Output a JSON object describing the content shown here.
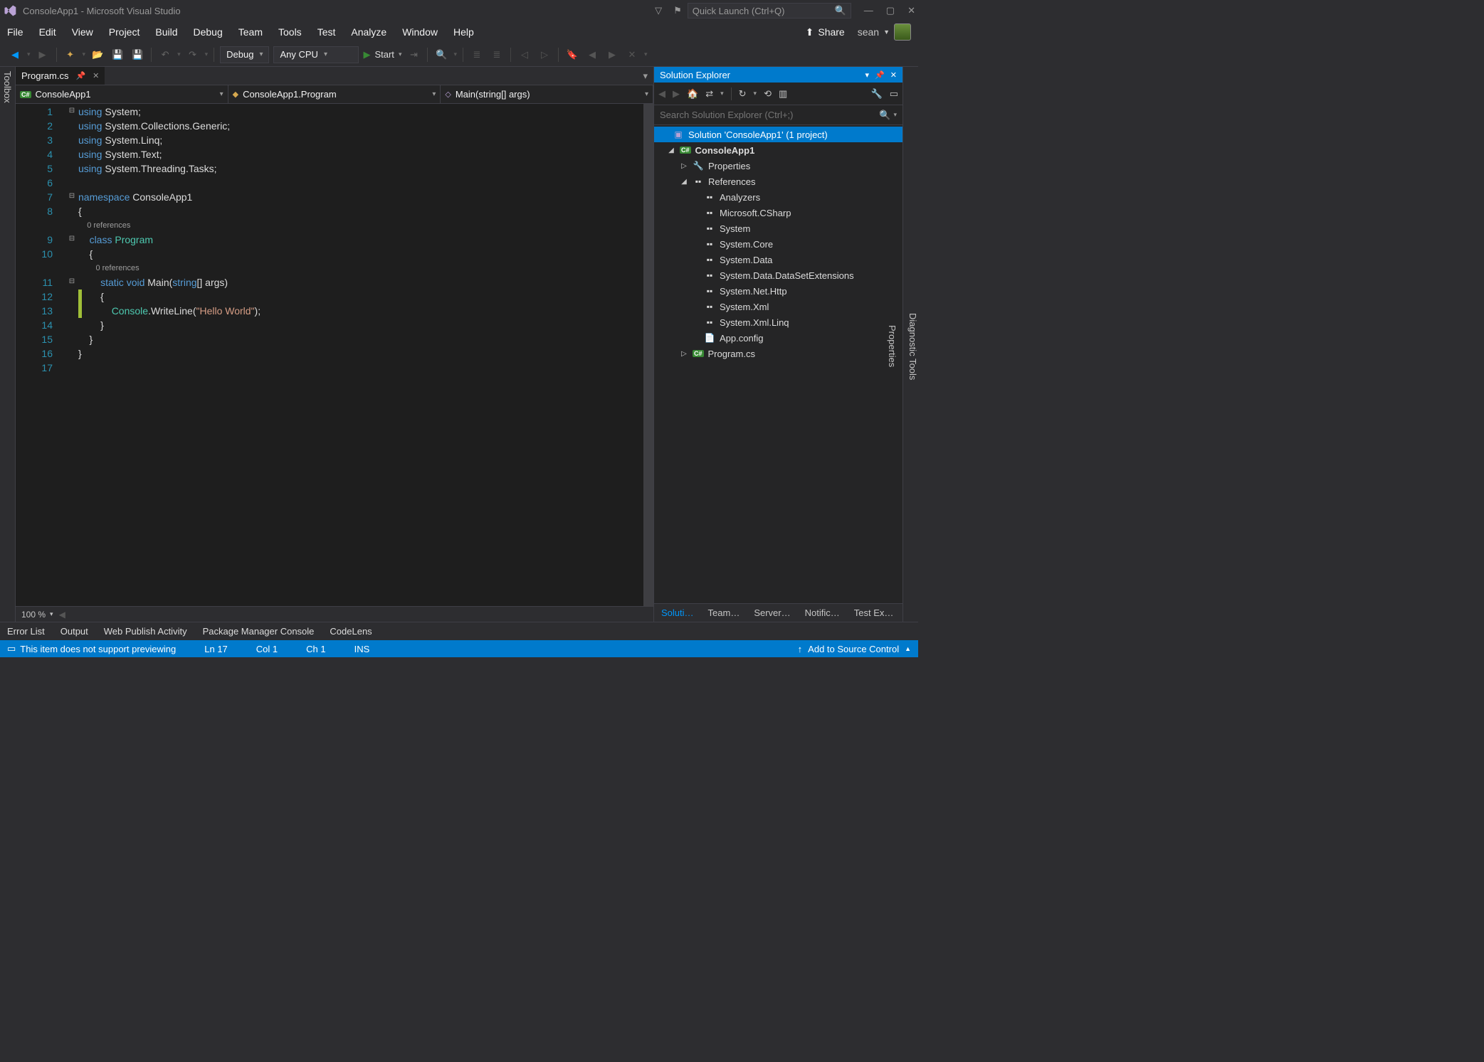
{
  "window": {
    "title": "ConsoleApp1 - Microsoft Visual Studio"
  },
  "quicklaunch": {
    "placeholder": "Quick Launch (Ctrl+Q)"
  },
  "menubar": {
    "items": [
      "File",
      "Edit",
      "View",
      "Project",
      "Build",
      "Debug",
      "Team",
      "Tools",
      "Test",
      "Analyze",
      "Window",
      "Help"
    ],
    "share": "Share",
    "user": "sean"
  },
  "toolbar": {
    "config": "Debug",
    "platform": "Any CPU",
    "start": "Start"
  },
  "left_tabs": [
    "Toolbox"
  ],
  "right_tabs": [
    "Diagnostic Tools",
    "Properties"
  ],
  "document": {
    "tab": "Program.cs",
    "nav1": "ConsoleApp1",
    "nav2": "ConsoleApp1.Program",
    "nav3": "Main(string[] args)",
    "refs": "0 references",
    "lines": [
      {
        "n": 1,
        "fold": "⊟",
        "tokens": [
          [
            "using ",
            "k-blue"
          ],
          [
            "System;",
            ""
          ]
        ]
      },
      {
        "n": 2,
        "fold": "",
        "tokens": [
          [
            "using ",
            "k-blue"
          ],
          [
            "System.Collections.Generic;",
            ""
          ]
        ]
      },
      {
        "n": 3,
        "fold": "",
        "tokens": [
          [
            "using ",
            "k-blue"
          ],
          [
            "System.Linq;",
            ""
          ]
        ]
      },
      {
        "n": 4,
        "fold": "",
        "tokens": [
          [
            "using ",
            "k-blue"
          ],
          [
            "System.Text;",
            ""
          ]
        ]
      },
      {
        "n": 5,
        "fold": "",
        "tokens": [
          [
            "using ",
            "k-blue"
          ],
          [
            "System.Threading.Tasks;",
            ""
          ]
        ]
      },
      {
        "n": 6,
        "fold": "",
        "tokens": [
          [
            "",
            ""
          ]
        ]
      },
      {
        "n": 7,
        "fold": "⊟",
        "tokens": [
          [
            "namespace ",
            "k-blue"
          ],
          [
            "ConsoleApp1",
            ""
          ]
        ]
      },
      {
        "n": 8,
        "fold": "",
        "tokens": [
          [
            "{",
            ""
          ]
        ]
      },
      {
        "ref": "    0 references"
      },
      {
        "n": 9,
        "fold": "⊟",
        "tokens": [
          [
            "    ",
            ""
          ],
          [
            "class ",
            "k-blue"
          ],
          [
            "Program",
            "k-teal"
          ]
        ]
      },
      {
        "n": 10,
        "fold": "",
        "tokens": [
          [
            "    {",
            ""
          ]
        ]
      },
      {
        "ref": "        0 references"
      },
      {
        "n": 11,
        "fold": "⊟",
        "tokens": [
          [
            "        ",
            ""
          ],
          [
            "static void ",
            "k-blue"
          ],
          [
            "Main(",
            ""
          ],
          [
            "string",
            "k-blue"
          ],
          [
            "[] args)",
            ""
          ]
        ]
      },
      {
        "n": 12,
        "fold": "",
        "tokens": [
          [
            "        {",
            ""
          ]
        ]
      },
      {
        "n": 13,
        "fold": "",
        "tokens": [
          [
            "            ",
            ""
          ],
          [
            "Console",
            "k-teal"
          ],
          [
            ".WriteLine(",
            ""
          ],
          [
            "\"Hello World\"",
            "k-str"
          ],
          [
            ");",
            ""
          ]
        ]
      },
      {
        "n": 14,
        "fold": "",
        "tokens": [
          [
            "        }",
            ""
          ]
        ]
      },
      {
        "n": 15,
        "fold": "",
        "tokens": [
          [
            "    }",
            ""
          ]
        ]
      },
      {
        "n": 16,
        "fold": "",
        "tokens": [
          [
            "}",
            ""
          ]
        ]
      },
      {
        "n": 17,
        "fold": "",
        "tokens": [
          [
            "",
            ""
          ]
        ]
      }
    ],
    "zoom": "100 %"
  },
  "solution_explorer": {
    "title": "Solution Explorer",
    "search_placeholder": "Search Solution Explorer (Ctrl+;)",
    "root": "Solution 'ConsoleApp1' (1 project)",
    "project": "ConsoleApp1",
    "nodes": {
      "properties": "Properties",
      "references": "References",
      "refs_list": [
        "Analyzers",
        "Microsoft.CSharp",
        "System",
        "System.Core",
        "System.Data",
        "System.Data.DataSetExtensions",
        "System.Net.Http",
        "System.Xml",
        "System.Xml.Linq"
      ],
      "appconfig": "App.config",
      "programcs": "Program.cs"
    }
  },
  "panel_tabs": [
    "Soluti…",
    "Team…",
    "Server…",
    "Notific…",
    "Test Ex…"
  ],
  "bottom_tabs": [
    "Error List",
    "Output",
    "Web Publish Activity",
    "Package Manager Console",
    "CodeLens"
  ],
  "statusbar": {
    "msg": "This item does not support previewing",
    "ln": "Ln 17",
    "col": "Col 1",
    "ch": "Ch 1",
    "ins": "INS",
    "src": "Add to Source Control"
  }
}
